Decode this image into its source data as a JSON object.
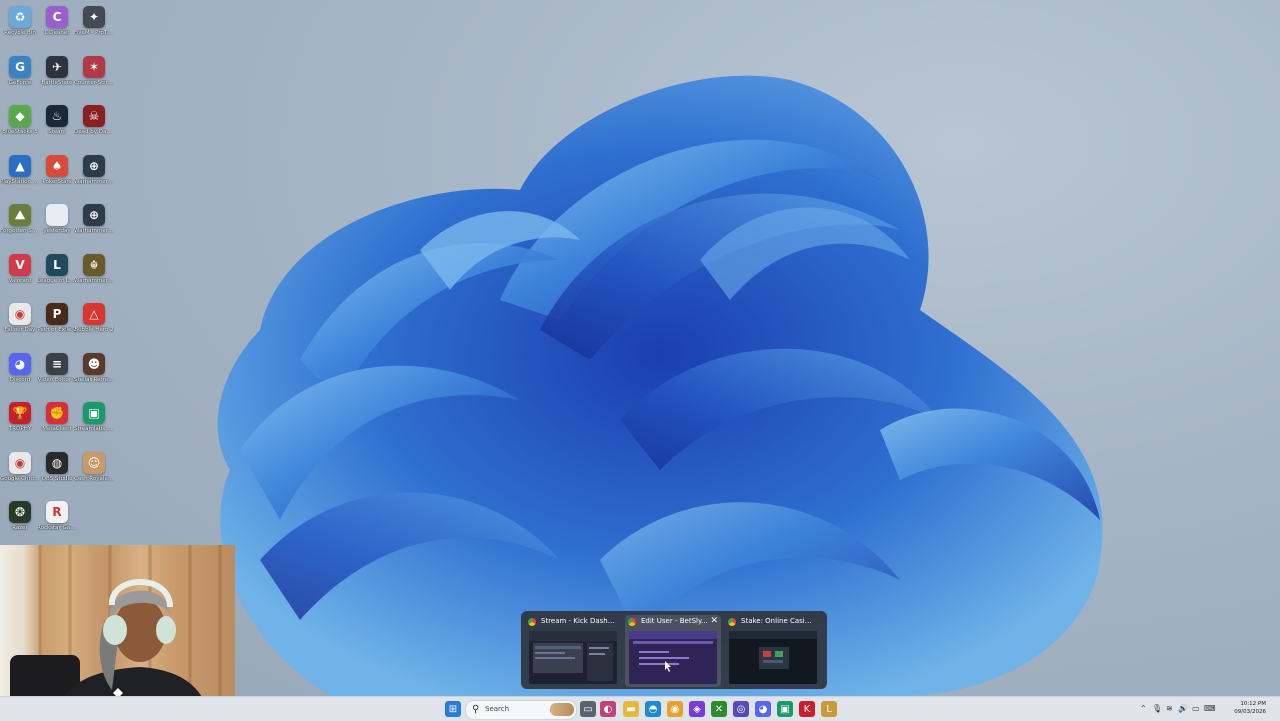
{
  "desktop": {
    "icons": [
      {
        "label": "Recycle Bin",
        "icon": "recycle-bin-icon",
        "color": "#6aa9d8",
        "glyph": "♻"
      },
      {
        "label": "CCleaner",
        "icon": "ccleaner-icon",
        "color": "#9a5fcf",
        "glyph": "C"
      },
      {
        "label": "FiveM - ProTuning",
        "icon": "fivem-icon",
        "color": "#444a52",
        "glyph": "✦"
      },
      {
        "label": "GeForce",
        "icon": "geforce-icon",
        "color": "#3b82c4",
        "glyph": "G"
      },
      {
        "label": "BattleState",
        "icon": "battlestate-icon",
        "color": "#2d3440",
        "glyph": "✈"
      },
      {
        "label": "Counter-Strike 2",
        "icon": "counter-strike-icon",
        "color": "#b03a48",
        "glyph": "✶"
      },
      {
        "label": "BlueStacks 5",
        "icon": "bluestacks-icon",
        "color": "#5aa84a",
        "glyph": "◆"
      },
      {
        "label": "Steam",
        "icon": "steam-icon",
        "color": "#1b2838",
        "glyph": "♨"
      },
      {
        "label": "Dead by Daylight",
        "icon": "dead-by-daylight-icon",
        "color": "#8a1f1f",
        "glyph": "☠"
      },
      {
        "label": "PlayStation Accessories",
        "icon": "playstation-icon",
        "color": "#2a6fc4",
        "glyph": "▲"
      },
      {
        "label": "PokerStars",
        "icon": "pokerstars-icon",
        "color": "#d84a3a",
        "glyph": "♠"
      },
      {
        "label": "Warhammer 40,000: Space",
        "icon": "warhammer-icon",
        "color": "#2e3b4a",
        "glyph": "⊕"
      },
      {
        "label": "Forgotten Shores",
        "icon": "game-icon",
        "color": "#6b7d3a",
        "glyph": "⛰"
      },
      {
        "label": "yesterday",
        "icon": "file-icon",
        "color": "#e9edf2",
        "glyph": ""
      },
      {
        "label": "Warhammer 40,000: Space",
        "icon": "warhammer-icon",
        "color": "#2e3b4a",
        "glyph": "⊕"
      },
      {
        "label": "Valorant",
        "icon": "valorant-icon",
        "color": "#d13a4a",
        "glyph": "V"
      },
      {
        "label": "League of Legends",
        "icon": "league-icon",
        "color": "#1f4a5c",
        "glyph": "L"
      },
      {
        "label": "Warhammer 40,000: Space",
        "icon": "warhammer-icon",
        "color": "#6a5a2a",
        "glyph": "☬"
      },
      {
        "label": "Fallout Day",
        "icon": "chrome-icon",
        "color": "#e8e8e8",
        "glyph": "◉"
      },
      {
        "label": "Path of Exile 2",
        "icon": "path-of-exile-icon",
        "color": "#4a2a1a",
        "glyph": "P"
      },
      {
        "label": "Bubble Hero 2",
        "icon": "bubble-hero-icon",
        "color": "#d8362e",
        "glyph": "△"
      },
      {
        "label": "Discord",
        "icon": "discord-icon",
        "color": "#5865f2",
        "glyph": "◕"
      },
      {
        "label": "Video Editor 3",
        "icon": "video-editor-icon",
        "color": "#3a3f48",
        "glyph": "≡"
      },
      {
        "label": "Stellar Retreat VR",
        "icon": "game-icon",
        "color": "#5a3a2a",
        "glyph": "☻"
      },
      {
        "label": "TROPHY",
        "icon": "trophy-icon",
        "color": "#c8202a",
        "glyph": "🏆"
      },
      {
        "label": "MetaClient",
        "icon": "metaclient-icon",
        "color": "#d82d3a",
        "glyph": "✊"
      },
      {
        "label": "Streamlabs Desktop",
        "icon": "streamlabs-icon",
        "color": "#1a9a6a",
        "glyph": "▣"
      },
      {
        "label": "Google Chrome",
        "icon": "chrome-icon",
        "color": "#e8e8e8",
        "glyph": "◉"
      },
      {
        "label": "OBS Studio",
        "icon": "obs-icon",
        "color": "#2a2a2a",
        "glyph": "◍"
      },
      {
        "label": "Cash Royale Club",
        "icon": "game-icon",
        "color": "#c89a6a",
        "glyph": "☺"
      },
      {
        "label": "Razer",
        "icon": "razer-icon",
        "color": "#2a3a2a",
        "glyph": "❂"
      },
      {
        "label": "Rockstar Games Launcher",
        "icon": "rockstar-icon",
        "color": "#f2f2f2",
        "glyph": "R"
      }
    ]
  },
  "thumbnails": [
    {
      "title": "Stream - Kick Dashboar...",
      "preview": "#1e2230"
    },
    {
      "title": "Edit User - BetSly...",
      "preview": "#3a2a6a"
    },
    {
      "title": "Stake: Online Casino & Sp...",
      "preview": "#121820"
    }
  ],
  "thumb_close_glyph": "✕",
  "taskbar": {
    "search_placeholder": "Search",
    "apps": [
      {
        "icon": "start-icon",
        "color": "#2b7bd8",
        "glyph": "⊞"
      },
      {
        "icon": "task-view-icon",
        "color": "#5a6470",
        "glyph": "▭"
      },
      {
        "icon": "colorful-app-icon",
        "color": "#c2417a",
        "glyph": "◐"
      },
      {
        "icon": "file-explorer-icon",
        "color": "#e6b840",
        "glyph": "▬"
      },
      {
        "icon": "edge-icon",
        "color": "#1f8ad4",
        "glyph": "◓"
      },
      {
        "icon": "chrome-icon",
        "color": "#e8a030",
        "glyph": "◉"
      },
      {
        "icon": "app-icon",
        "color": "#7a3ad8",
        "glyph": "◈"
      },
      {
        "icon": "xbox-icon",
        "color": "#2e8b2e",
        "glyph": "✕"
      },
      {
        "icon": "app-icon",
        "color": "#5a4ab8",
        "glyph": "◎"
      },
      {
        "icon": "discord-icon",
        "color": "#5865f2",
        "glyph": "◕"
      },
      {
        "icon": "streamlabs-icon",
        "color": "#1a9a6a",
        "glyph": "▣"
      },
      {
        "icon": "app-icon",
        "color": "#c8202a",
        "glyph": "K"
      },
      {
        "icon": "league-icon",
        "color": "#c89a3a",
        "glyph": "L"
      },
      {
        "icon": "app-icon",
        "color": "#d86a3a",
        "glyph": "⚙"
      }
    ],
    "time": "10:12 PM",
    "date": "09/03/2026"
  }
}
